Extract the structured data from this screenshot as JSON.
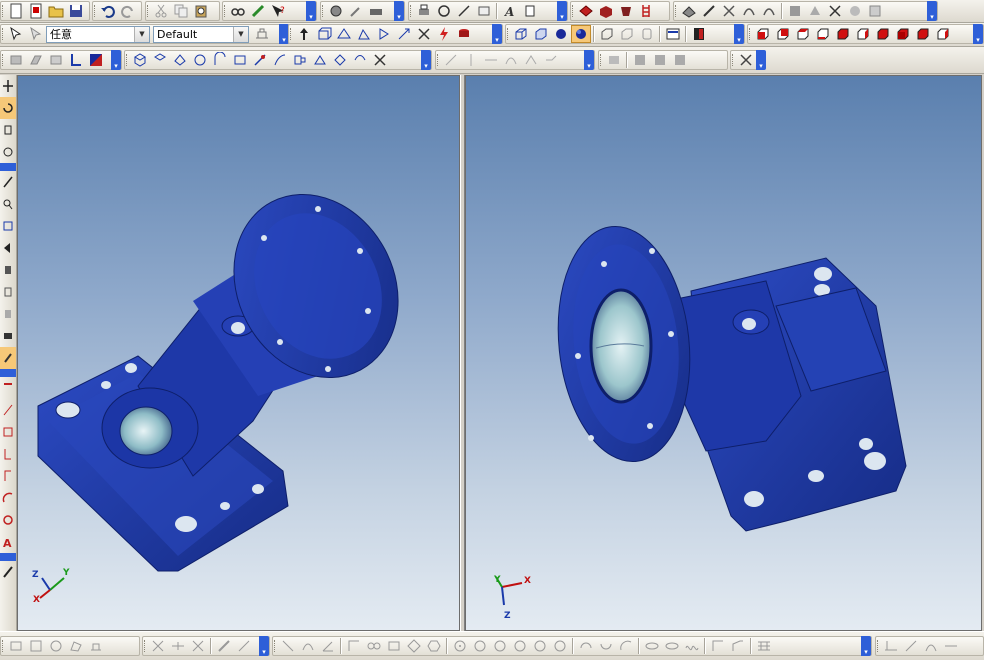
{
  "toolbars": {
    "row1_icons": [
      "new-icon",
      "new-doc-icon",
      "open-icon",
      "save-icon",
      "undo-icon",
      "redo-icon",
      "cut-icon",
      "copy-icon",
      "paste-icon",
      "find-icon",
      "insert-icon",
      "help-icon",
      "analysis-icon",
      "tool-icon",
      "settings-icon",
      "print-icon",
      "chain-icon",
      "dim-icon",
      "text-icon",
      "note-icon",
      "solid-red-icon",
      "solid-box-icon",
      "solid-alt-icon",
      "ladder-icon",
      "machining-icon",
      "bevel-icon",
      "trim-icon",
      "cross-icon",
      "sweep-icon",
      "gear-icon",
      "paint-icon",
      "plus-icon"
    ],
    "row2_icons": [
      "select-icon",
      "select-alt-icon",
      "hierarchy-icon",
      "arrow-up-icon",
      "box-icon",
      "move-icon",
      "rotate-icon",
      "mirror-icon",
      "scale-icon",
      "delete-icon",
      "lightning-icon",
      "stack-icon",
      "cube-wire-icon",
      "cube-edge-icon",
      "sphere-icon",
      "sphere-shaded-icon",
      "cube-hidden-icon",
      "cube-alt-icon",
      "cylinder-icon",
      "panel-icon",
      "bookmark-icon",
      "view-front-icon",
      "view-back-icon",
      "view-top-icon",
      "view-bottom-icon",
      "view-left-icon",
      "view-right-icon",
      "view-iso-icon",
      "view-iso2-icon",
      "view-iso3-icon",
      "view-iso4-icon"
    ],
    "row3_icons": [
      "block-icon",
      "block-alt-icon",
      "block3-icon",
      "corner-icon",
      "frame-icon",
      "surface-icon",
      "surface2-icon",
      "surface3-icon",
      "surface4-icon",
      "surface5-icon",
      "surface6-icon",
      "surface7-icon",
      "surface8-icon",
      "surface9-icon",
      "surface10-icon",
      "surface11-icon",
      "surface12-icon",
      "surface13-icon",
      "line-icon",
      "vline-icon",
      "hline-icon",
      "curve-icon",
      "curve2-icon",
      "bend-icon",
      "move2-icon",
      "solid2-icon",
      "solid3-icon",
      "solid4-icon",
      "cross2-icon"
    ],
    "combo1": {
      "value": "任意"
    },
    "combo2": {
      "value": "Default"
    }
  },
  "left_toolbar_icons": [
    "move-icon",
    "rotate-view-icon",
    "pan-icon",
    "orbit-icon",
    "zoom-icon",
    "zoom-window-icon",
    "fit-icon",
    "prev-view-icon",
    "snap-icon",
    "snap2-icon",
    "snap3-icon",
    "measure-icon",
    "measure2-icon",
    "pick-icon",
    "line-tool-icon",
    "rect-tool-icon",
    "bracket-icon",
    "corner-tool-icon",
    "arc-icon",
    "circle-tool-icon",
    "text-tool-icon",
    "pen-icon"
  ],
  "bottom_icons": [
    "rect-sel-icon",
    "window-icon",
    "lasso-icon",
    "poly-icon",
    "stamp-icon",
    "cross-sel-icon",
    "split-icon",
    "cut-sel-icon",
    "pen2-icon",
    "knife-icon",
    "line2-icon",
    "arc2-icon",
    "angle-icon",
    "dim2-icon",
    "chain2-icon",
    "rect2-icon",
    "diamond-icon",
    "hexagon-icon",
    "circle-ring-icon",
    "circle2-icon",
    "circle3-icon",
    "circle4-icon",
    "circle5-icon",
    "circle6-icon",
    "arc-cw-icon",
    "arc-ccw-icon",
    "arc3-icon",
    "ellipse-icon",
    "ellipse2-icon",
    "spline-icon",
    "corner2-icon",
    "corner3-icon",
    "table-icon",
    "dim-h-icon",
    "dim-a-icon",
    "dim-r-icon",
    "dim-l-icon"
  ],
  "viewports": {
    "left": {
      "axis_labels": {
        "x": "X",
        "y": "Y",
        "z": "Z"
      }
    },
    "right": {
      "axis_labels": {
        "x": "X",
        "y": "Y",
        "z": "Z"
      }
    }
  },
  "colors": {
    "part_blue": "#1f3fa8",
    "part_dark": "#14287a",
    "accent_chevron": "#2e5fd8"
  }
}
